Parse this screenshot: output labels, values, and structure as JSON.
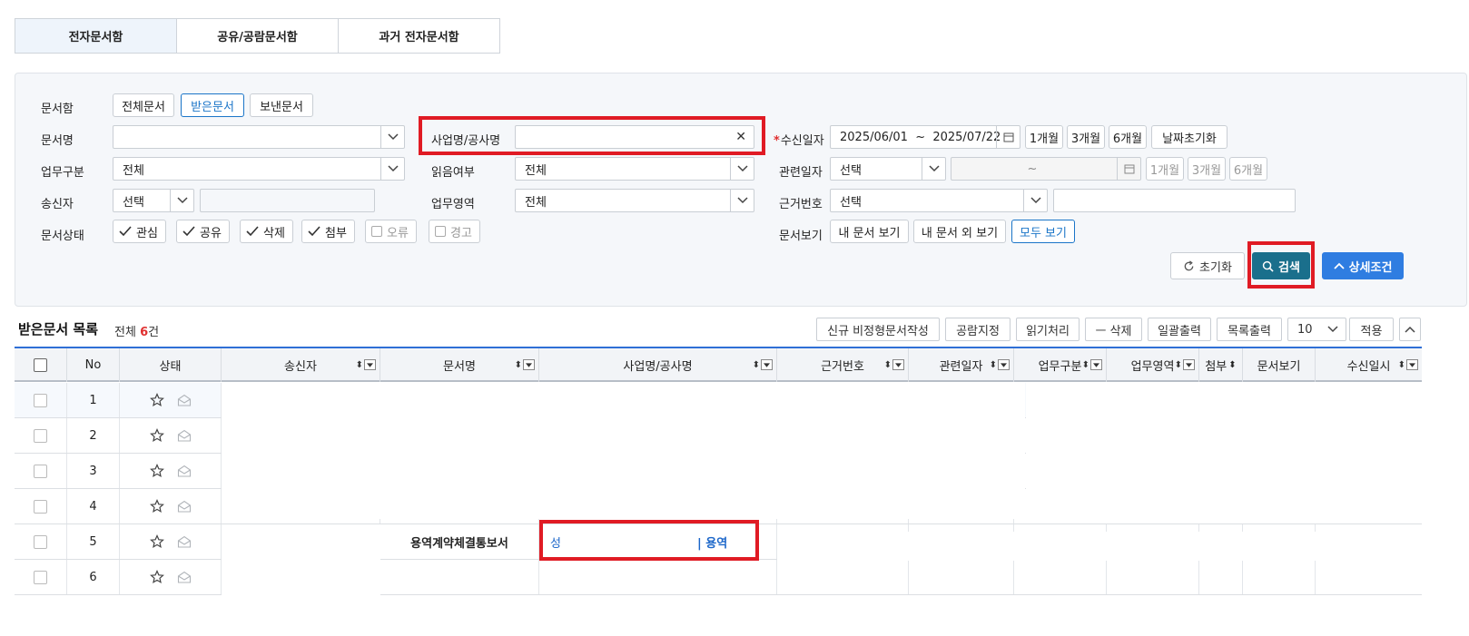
{
  "tabs": [
    "전자문서함",
    "공유/공람문서함",
    "과거 전자문서함"
  ],
  "filters": {
    "doc_box_label": "문서함",
    "doc_box_options": [
      "전체문서",
      "받은문서",
      "보낸문서"
    ],
    "doc_name_label": "문서명",
    "business_name_label": "사업명/공사명",
    "receive_date_label": "수신일자",
    "receive_date_range": "2025/06/01  ~  2025/07/22",
    "period_buttons": [
      "1개월",
      "3개월",
      "6개월"
    ],
    "date_reset": "날짜초기화",
    "work_type_label": "업무구분",
    "work_type_value": "전체",
    "read_label": "읽음여부",
    "read_value": "전체",
    "related_date_label": "관련일자",
    "related_date_type": "선택",
    "related_date_range": "~",
    "sender_label": "송신자",
    "sender_type": "선택",
    "work_area_label": "업무영역",
    "work_area_value": "전체",
    "basis_no_label": "근거번호",
    "basis_no_type": "선택",
    "status_label": "문서상태",
    "status_checked": [
      "관심",
      "공유",
      "삭제",
      "첨부"
    ],
    "status_unchecked": [
      "오류",
      "경고"
    ],
    "view_label": "문서보기",
    "view_options": [
      "내 문서 보기",
      "내 문서 외 보기",
      "모두 보기"
    ],
    "reset_button": "초기화",
    "search_button": "검색",
    "detail_button": "상세조건"
  },
  "list": {
    "title": "받은문서 목록",
    "count_prefix": "전체 ",
    "count": "6",
    "count_suffix": "건",
    "toolbar": [
      "신규 비정형문서작성",
      "공람지정",
      "읽기처리",
      "ㅡ 삭제",
      "일괄출력",
      "목록출력"
    ],
    "page_size": "10",
    "apply": "적용",
    "columns": [
      "No",
      "상태",
      "송신자",
      "문서명",
      "사업명/공사명",
      "근거번호",
      "관련일자",
      "업무구분",
      "업무영역",
      "첨부",
      "문서보기",
      "수신일시"
    ],
    "rows": [
      {
        "no": "1"
      },
      {
        "no": "2"
      },
      {
        "no": "3"
      },
      {
        "no": "4"
      },
      {
        "no": "5",
        "doc_name": "용역계약체결통보서",
        "business_start": "성",
        "business_end": "| 용역"
      },
      {
        "no": "6"
      }
    ]
  }
}
